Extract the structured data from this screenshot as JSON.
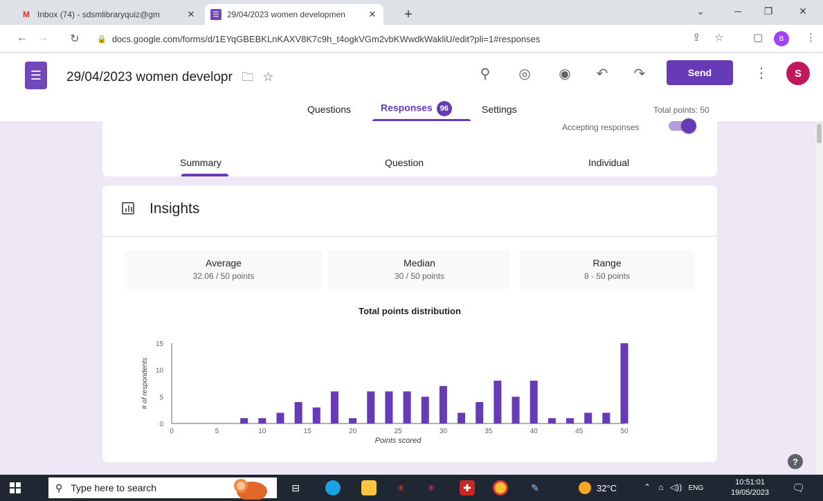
{
  "browser": {
    "tabs": [
      {
        "title": "Inbox (74) - sdsmlibraryquiz@gm",
        "active": false
      },
      {
        "title": "29/04/2023 women developmen",
        "active": true
      }
    ],
    "new_tab": "+",
    "url": "docs.google.com/forms/d/1EYqGBEBKLnKAXV8K7c9h_t4ogkVGm2vbKWwdkWakliU/edit?pli=1#responses",
    "profile_initial": "B"
  },
  "form": {
    "title": "29/04/2023 women developr",
    "send_label": "Send",
    "avatar_initial": "S",
    "nav": {
      "questions": "Questions",
      "responses": "Responses",
      "responses_count": "96",
      "settings": "Settings"
    },
    "total_points": "Total points: 50",
    "accepting_label": "Accepting responses",
    "accepting": true,
    "subtabs": [
      "Summary",
      "Question",
      "Individual"
    ]
  },
  "insights": {
    "title": "Insights",
    "stats": [
      {
        "label": "Average",
        "value": "32.06 / 50 points"
      },
      {
        "label": "Median",
        "value": "30 / 50 points"
      },
      {
        "label": "Range",
        "value": "8 - 50 points"
      }
    ]
  },
  "chart_data": {
    "type": "bar",
    "title": "Total points distribution",
    "xlabel": "Points scored",
    "ylabel": "# of respondents",
    "xlim": [
      0,
      50
    ],
    "ylim": [
      0,
      15
    ],
    "xticks": [
      0,
      5,
      10,
      15,
      20,
      25,
      30,
      35,
      40,
      45,
      50
    ],
    "yticks": [
      0,
      5,
      10,
      15
    ],
    "x": [
      8,
      10,
      12,
      14,
      16,
      18,
      20,
      22,
      24,
      26,
      28,
      30,
      32,
      34,
      36,
      38,
      40,
      42,
      44,
      46,
      48,
      50
    ],
    "values": [
      1,
      1,
      2,
      4,
      3,
      6,
      1,
      6,
      6,
      6,
      5,
      7,
      2,
      4,
      8,
      5,
      8,
      1,
      1,
      2,
      2,
      15
    ],
    "color": "#673ab7"
  },
  "taskbar": {
    "search_placeholder": "Type here to search",
    "temperature": "32°C",
    "language": "ENG",
    "time": "10:51:01",
    "date": "19/05/2023"
  },
  "colors": {
    "accent": "#673ab7",
    "background": "#ede7f6"
  }
}
